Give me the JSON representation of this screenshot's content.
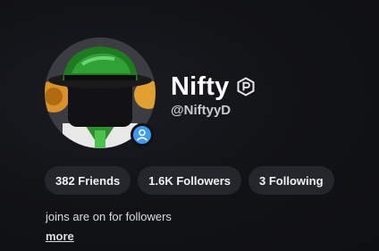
{
  "profile": {
    "display_name": "Nifty",
    "username": "@NiftyyD",
    "premium_icon": "premium-badge-icon",
    "presence_icon": "user-presence-icon",
    "presence_color": "#3b9bf0"
  },
  "stats": {
    "friends": "382 Friends",
    "followers": "1.6K Followers",
    "following": "3 Following"
  },
  "about": {
    "text": "joins are on for followers",
    "more_label": "more"
  },
  "colors": {
    "background": "#0f1014",
    "pill": "#25262c",
    "accent": "#3b9bf0"
  }
}
